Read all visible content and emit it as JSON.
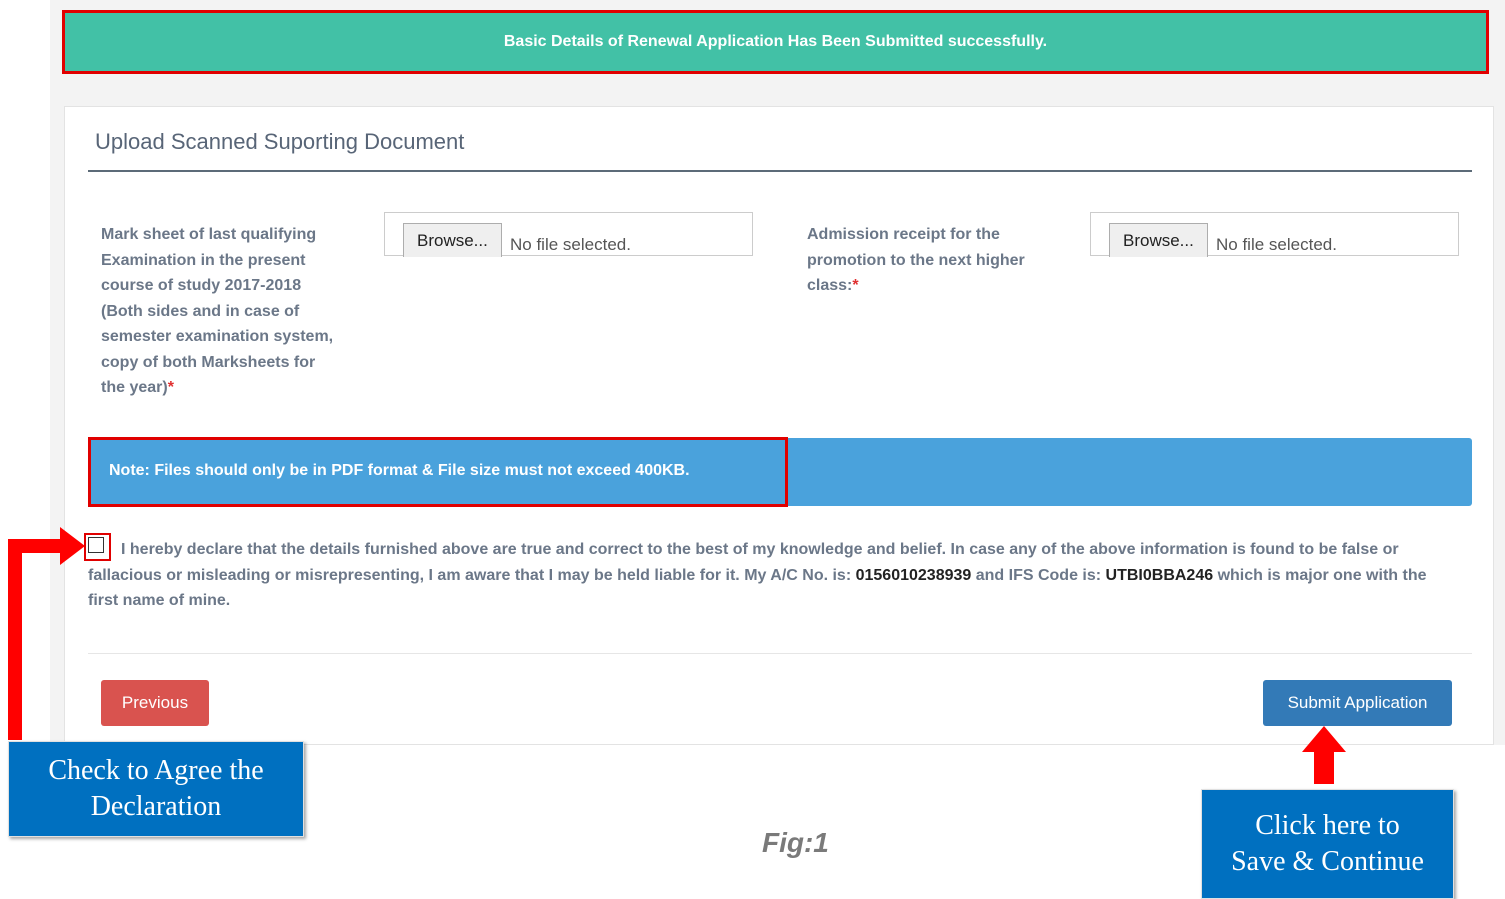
{
  "banner": {
    "message": "Basic Details of Renewal Application Has Been Submitted successfully."
  },
  "section": {
    "title": "Upload Scanned Suporting Document"
  },
  "fields": [
    {
      "label_lines": [
        "Mark sheet of last qualifying",
        "Examination in the present",
        "course of study 2017-2018",
        "(Both sides and in case of",
        "semester examination system,",
        "copy of both Marksheets for",
        "the year)"
      ],
      "required_mark": "*",
      "browse_label": "Browse...",
      "file_status": "No file selected."
    },
    {
      "label_lines": [
        "Admission receipt for the",
        "promotion to the next higher",
        "class:"
      ],
      "required_mark": "*",
      "browse_label": "Browse...",
      "file_status": "No file selected."
    }
  ],
  "note": {
    "text": "Note: Files should only be in PDF format & File size must not exceed 400KB."
  },
  "declaration": {
    "checked": false,
    "text_before_ac": "I hereby declare that the details furnished above are true and correct to the best of my knowledge and belief. In case any of the above information is found to be false or fallacious or misleading or misrepresenting, I am aware that I may be held liable for it. My A/C No. is: ",
    "ac_no": "0156010238939",
    "text_middle": " and IFS Code is: ",
    "ifs_code": "UTBI0BBA246",
    "text_after": " which is major one with the first name of mine."
  },
  "buttons": {
    "previous": "Previous",
    "submit": "Submit Application"
  },
  "callouts": {
    "left_lines": [
      "Check to Agree the",
      "Declaration"
    ],
    "right_lines": [
      "Click here to",
      "Save & Continue"
    ]
  },
  "caption": "Fig:1",
  "colors": {
    "banner_bg": "#42c1a6",
    "note_bg": "#4aa2dc",
    "highlight_red": "#e00000",
    "previous_btn": "#d9534f",
    "submit_btn": "#337ab7",
    "callout_bg": "#0070c0"
  }
}
